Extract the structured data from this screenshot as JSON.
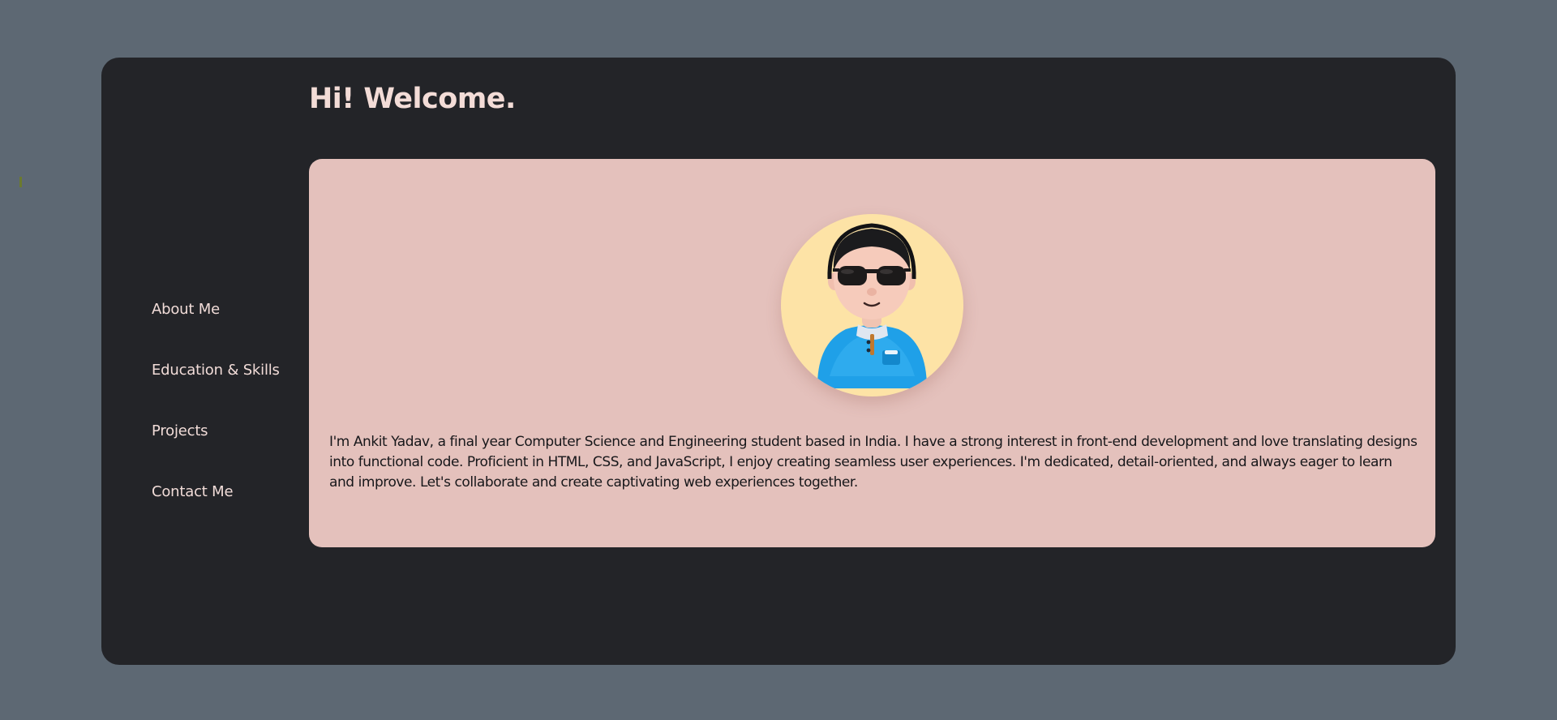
{
  "header": {
    "title": "Hi! Welcome."
  },
  "sidebar": {
    "items": [
      {
        "label": "About Me"
      },
      {
        "label": "Education & Skills"
      },
      {
        "label": "Projects"
      },
      {
        "label": "Contact Me"
      }
    ]
  },
  "about": {
    "avatar_icon": "avatar-illustration-icon",
    "bio": "I'm Ankit Yadav, a final year Computer Science and Engineering student based in India. I have a strong interest in front-end development and love translating designs into functional code. Proficient in HTML, CSS, and JavaScript, I enjoy creating seamless user experiences. I'm dedicated, detail-oriented, and always eager to learn and improve. Let's collaborate and create captivating web experiences together."
  },
  "colors": {
    "page_background": "#5d6873",
    "app_background": "#232428",
    "card_background": "#e4c1bc",
    "title_text": "#f3dcd7",
    "nav_text": "#f1dcd8",
    "avatar_background": "#fde3a6",
    "shirt_blue": "#1fa0e8"
  }
}
